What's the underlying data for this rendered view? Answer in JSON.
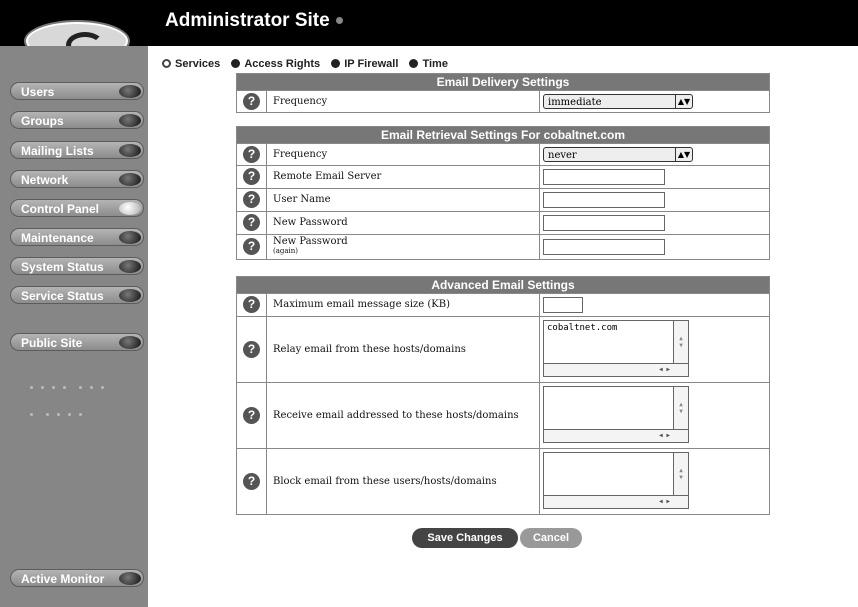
{
  "app": {
    "title": "Administrator Site"
  },
  "sidebar": {
    "items": [
      {
        "label": "Users"
      },
      {
        "label": "Groups"
      },
      {
        "label": "Mailing Lists"
      },
      {
        "label": "Network"
      },
      {
        "label": "Control Panel"
      },
      {
        "label": "Maintenance"
      },
      {
        "label": "System Status"
      },
      {
        "label": "Service Status"
      }
    ],
    "public_site": "Public Site",
    "active_monitor": "Active Monitor"
  },
  "tabs": [
    {
      "label": "Services"
    },
    {
      "label": "Access Rights"
    },
    {
      "label": "IP Firewall"
    },
    {
      "label": "Time"
    }
  ],
  "delivery": {
    "title": "Email Delivery Settings",
    "frequency_label": "Frequency",
    "frequency_value": "immediate"
  },
  "retrieval": {
    "title": "Email Retrieval Settings For cobaltnet.com",
    "frequency_label": "Frequency",
    "frequency_value": "never",
    "server_label": "Remote Email Server",
    "user_label": "User Name",
    "password_label": "New Password",
    "password_again_label": "New Password",
    "password_again_sub": "(again)"
  },
  "advanced": {
    "title": "Advanced Email Settings",
    "max_size_label": "Maximum email message size (KB)",
    "relay_label": "Relay email from these hosts/domains",
    "relay_value": "cobaltnet.com",
    "receive_label": "Receive email addressed to these hosts/domains",
    "block_label": "Block email from these users/hosts/domains"
  },
  "actions": {
    "save": "Save Changes",
    "cancel": "Cancel"
  },
  "help_glyph": "?"
}
